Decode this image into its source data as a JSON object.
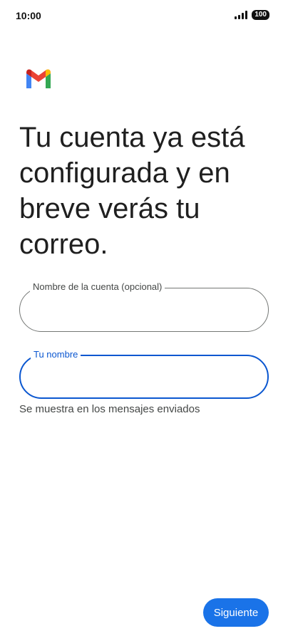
{
  "status_bar": {
    "time": "10:00",
    "battery": "100",
    "signal_icon": "signal-bars-icon"
  },
  "logo": {
    "icon": "gmail-logo-icon",
    "colors": {
      "blue": "#4285F4",
      "red": "#EA4335",
      "yellow": "#FBBC04",
      "green": "#34A853",
      "dark_red": "#C5221F"
    }
  },
  "headline": "Tu cuenta ya está configurada y en breve verás tu correo.",
  "form": {
    "account_name": {
      "label": "Nombre de la cuenta (opcional)",
      "value": ""
    },
    "your_name": {
      "label": "Tu nombre",
      "value": "",
      "helper": "Se muestra en los mensajes enviados",
      "focused": true
    }
  },
  "actions": {
    "next_label": "Siguiente"
  },
  "colors": {
    "accent": "#1a73e8",
    "focus_border": "#0b57d0",
    "outline": "#747775"
  }
}
